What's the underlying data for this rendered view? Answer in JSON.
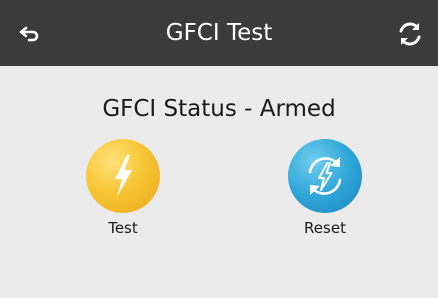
{
  "header": {
    "title": "GFCI Test",
    "back_icon": "back-arrow-icon",
    "refresh_icon": "refresh-icon"
  },
  "status": {
    "text": "GFCI Status - Armed"
  },
  "actions": [
    {
      "label": "Test",
      "icon": "lightning-bolt-icon",
      "color": "#f3b72a"
    },
    {
      "label": "Reset",
      "icon": "reset-bolt-icon",
      "color": "#2aa3d6"
    }
  ],
  "colors": {
    "header_bg": "#3b3b3b",
    "page_bg": "#ebebeb"
  }
}
